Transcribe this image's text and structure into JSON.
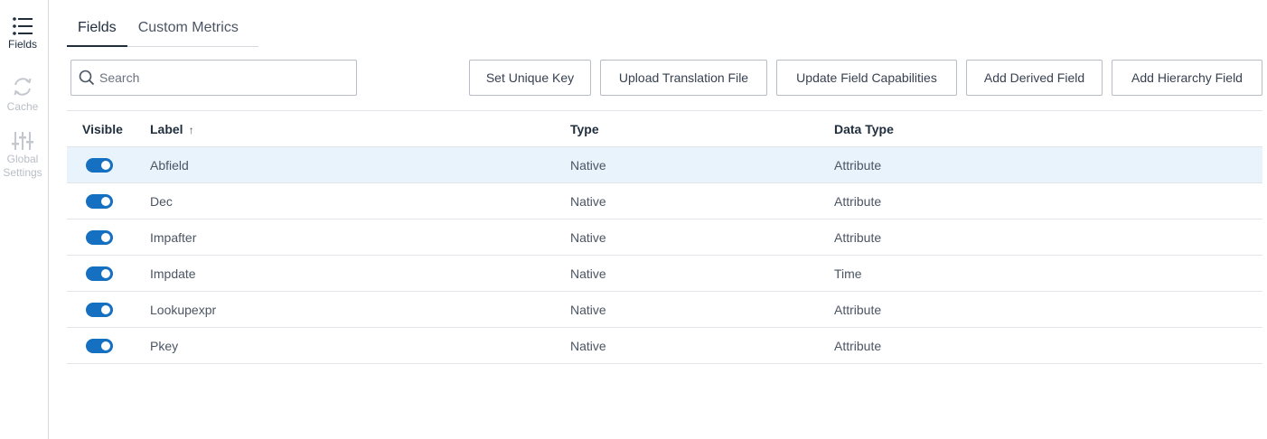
{
  "rail": {
    "fields": "Fields",
    "cache": "Cache",
    "global_line1": "Global",
    "global_line2": "Settings"
  },
  "tabs": [
    "Fields",
    "Custom Metrics"
  ],
  "search": {
    "placeholder": "Search",
    "value": ""
  },
  "toolbar": {
    "set_unique_key": "Set Unique Key",
    "upload_translation": "Upload Translation File",
    "update_capabilities": "Update Field Capabilities",
    "add_derived": "Add Derived Field",
    "add_hierarchy": "Add Hierarchy Field"
  },
  "table": {
    "headers": {
      "visible": "Visible",
      "label": "Label",
      "sort_indicator": "↑",
      "type": "Type",
      "data_type": "Data Type"
    },
    "rows": [
      {
        "visible": true,
        "label": "Abfield",
        "type": "Native",
        "data_type": "Attribute",
        "highlighted": true
      },
      {
        "visible": true,
        "label": "Dec",
        "type": "Native",
        "data_type": "Attribute",
        "highlighted": false
      },
      {
        "visible": true,
        "label": "Impafter",
        "type": "Native",
        "data_type": "Attribute",
        "highlighted": false
      },
      {
        "visible": true,
        "label": "Impdate",
        "type": "Native",
        "data_type": "Time",
        "highlighted": false
      },
      {
        "visible": true,
        "label": "Lookupexpr",
        "type": "Native",
        "data_type": "Attribute",
        "highlighted": false
      },
      {
        "visible": true,
        "label": "Pkey",
        "type": "Native",
        "data_type": "Attribute",
        "highlighted": false
      }
    ]
  },
  "colors": {
    "accent": "#1570c2",
    "row_highlight": "#e8f3fc",
    "active_text": "#1f2d3d"
  },
  "icons": {
    "fields": "list-icon",
    "cache": "refresh-icon",
    "global": "sliders-icon",
    "search": "search-icon"
  }
}
